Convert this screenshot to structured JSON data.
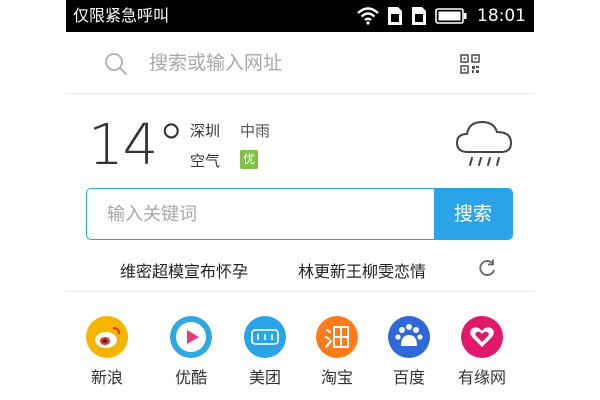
{
  "status_bar": {
    "carrier_text": "仅限紧急呼叫",
    "time": "18:01",
    "icons": [
      "wifi-icon",
      "sim1-icon",
      "sim2-icon",
      "battery-icon"
    ]
  },
  "search": {
    "placeholder": "搜索或输入网址",
    "icons": [
      "search-icon",
      "qr-code-icon"
    ]
  },
  "weather": {
    "temperature": "14°",
    "city": "深圳",
    "condition": "中雨",
    "air_label": "空气",
    "air_quality": "优",
    "icon": "rain-cloud-icon"
  },
  "keyword_search": {
    "placeholder": "输入关键词",
    "button_label": "搜索"
  },
  "hot_words": [
    "维密超模宣布怀孕",
    "林更新王柳雯恋情"
  ],
  "hot_refresh_icon": "refresh-icon",
  "apps": [
    {
      "label": "新浪",
      "icon": "weibo-icon",
      "color": "#f5b400"
    },
    {
      "label": "优酷",
      "icon": "youku-play-icon",
      "color": "#2fa7e0"
    },
    {
      "label": "美团",
      "icon": "meituan-icon",
      "color": "#2ba3e8"
    },
    {
      "label": "淘宝",
      "icon": "taobao-icon",
      "color": "#ff7a1a"
    },
    {
      "label": "百度",
      "icon": "baidu-paw-icon",
      "color": "#2f69d8"
    },
    {
      "label": "有缘网",
      "icon": "youyuan-heart-icon",
      "color": "#e2186b"
    }
  ],
  "colors": {
    "accent": "#2ba3e8",
    "air_quality_badge": "#7cc243"
  }
}
